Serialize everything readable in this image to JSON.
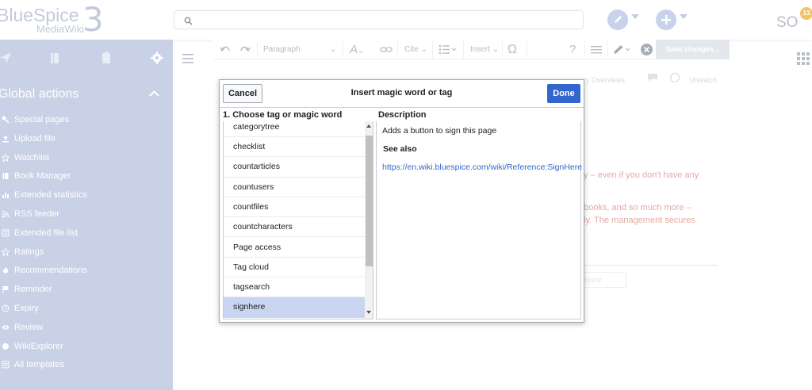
{
  "header": {
    "logo_main": "BlueSpice",
    "logo_sub": "MediaWiki",
    "logo_num": "3",
    "avatar_initials": "SO",
    "notification_count": "13",
    "search_placeholder": ""
  },
  "sidebar": {
    "title": "Global actions",
    "items": [
      {
        "label": "Special pages",
        "icon": "key-icon"
      },
      {
        "label": "Upload file",
        "icon": "upload-icon"
      },
      {
        "label": "Watchlist",
        "icon": "star-icon"
      },
      {
        "label": "Book Manager",
        "icon": "book-icon"
      },
      {
        "label": "Extended statistics",
        "icon": "bar-chart-icon"
      },
      {
        "label": "RSS feeder",
        "icon": "rss-icon"
      },
      {
        "label": "Extended file list",
        "icon": "list-icon"
      },
      {
        "label": "Ratings",
        "icon": "star-outline-icon"
      },
      {
        "label": "Recommendations",
        "icon": "fire-icon"
      },
      {
        "label": "Reminder",
        "icon": "flag-icon"
      },
      {
        "label": "Expiry",
        "icon": "clock-icon"
      },
      {
        "label": "Review",
        "icon": "eye-icon"
      },
      {
        "label": "WikiExplorer",
        "icon": "globe-icon"
      },
      {
        "label": "All templates",
        "icon": "template-icon"
      }
    ]
  },
  "toolbar": {
    "paragraph": "Paragraph",
    "cite": "Cite",
    "insert": "Insert",
    "save": "Save changes..."
  },
  "background": {
    "line1": "y – even if you don't have any",
    "line2": "books, and so much more –",
    "line3": "ly. The management secures",
    "meta": "ry Overviews",
    "meta2": "Unwatch",
    "box": "Spice"
  },
  "dialog": {
    "title": "Insert magic word or tag",
    "cancel_label": "Cancel",
    "done_label": "Done",
    "left_heading": "1. Choose tag or magic word",
    "right_heading": "Description",
    "tags": [
      "categorytree",
      "checklist",
      "countarticles",
      "countusers",
      "countfiles",
      "countcharacters",
      "Page access",
      "Tag cloud",
      "tagsearch",
      "signhere"
    ],
    "selected": "signhere",
    "description": "Adds a button to sign this page",
    "see_also": "See also",
    "link": "https://en.wiki.bluespice.com/wiki/Reference:SignHere"
  },
  "colors": {
    "sidebar_bg": "#c9d1e6",
    "accent": "#3366cc",
    "selected_row": "#c9d4f0"
  }
}
